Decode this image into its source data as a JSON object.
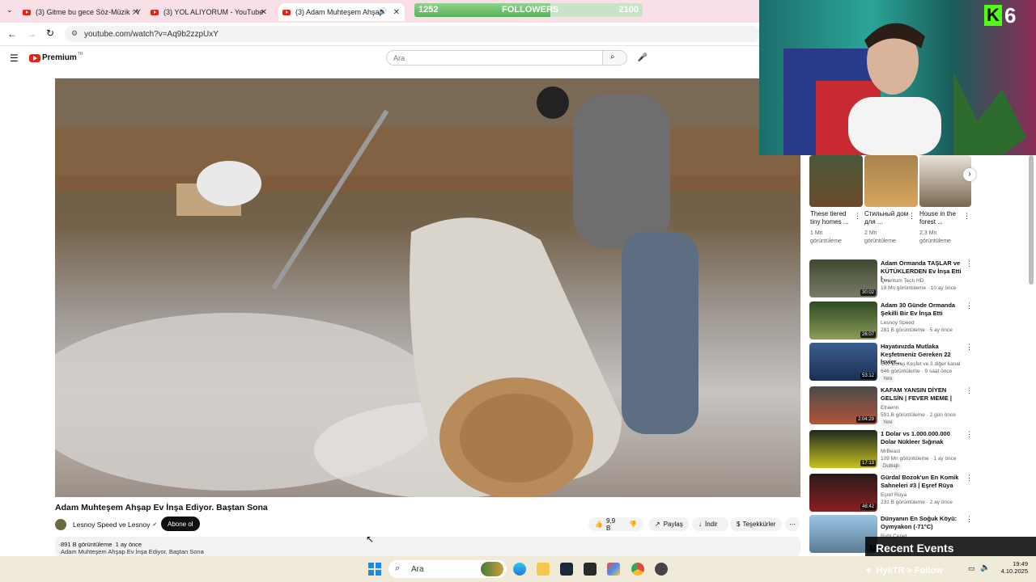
{
  "browser": {
    "tabs": [
      {
        "label": "(3) Gitme bu gece Söz-Müzik : Y"
      },
      {
        "label": "(3) YOL ALIYORUM - YouTube"
      },
      {
        "label": "(3) Adam Muhteşem Ahşap"
      }
    ],
    "url": "youtube.com/watch?v=Aq9b2zzpUxY"
  },
  "stream_overlay": {
    "followers_current": "1252",
    "followers_label": "FOLLOWERS",
    "followers_goal": "2100",
    "followers_progress": 0.596,
    "webcam_badge": "6",
    "recent_events": "Recent Events",
    "follow_cta": "HykTR > Follow"
  },
  "youtube": {
    "brand": "Premium",
    "region": "TR",
    "search_placeholder": "Ara",
    "video": {
      "title": "Adam Muhteşem Ahşap Ev İnşa Ediyor. Baştan Sona",
      "channel": "Lesnoy Speed ve Lesnoy",
      "subscribe": "Abone ol",
      "likes": "9,9 B",
      "share": "Paylaş",
      "download": "İndir",
      "thanks": "Teşekkürler",
      "views": "891 B görüntüleme",
      "age": "1 ay önce",
      "desc_line": "Adam Muhteşem Ahşap Ev İnşa Ediyor. Baştan Sona"
    },
    "shelf": [
      {
        "title": "These tiered tiny homes ...",
        "meta": "1 Mn görüntüleme"
      },
      {
        "title": "Стильный дом для ...",
        "meta": "2 Mn görüntüleme"
      },
      {
        "title": "House in the forest ...",
        "meta": "2,3 Mn görüntüleme"
      }
    ],
    "recommendations": [
      {
        "title": "Adam Ormanda TAŞLAR ve KÜTÜKLERDEN Ev İnşa Etti | ...",
        "channel": "Quantum Tech HD",
        "meta": "19 Mn görüntüleme · 10 ay önce",
        "duration": "30:02"
      },
      {
        "title": "Adam 30 Günde Ormanda Şekilli Bir Ev İnşa Etti",
        "channel": "Lesnoy Speed",
        "meta": "281 B görüntüleme · 5 ay önce",
        "duration": "26:07"
      },
      {
        "title": "Hayatınızda Mutlaka Keşfetmeniz Gereken 22 İsviçr...",
        "channel": "Gez Dolaş Keşfet ve 3 diğer kanal",
        "meta": "646 görüntüleme · 9 saat önce",
        "duration": "53:12",
        "badge": "Yeni"
      },
      {
        "title": "KAFAM YANSIN DİYEN GELSİN | FEVER MEME |",
        "channel": "Elraenn",
        "meta": "591 B görüntüleme · 2 gün önce",
        "duration": "2:04:29",
        "badge": "Yeni"
      },
      {
        "title": "1 Dolar vs 1.000.000.000 Dolar Nükleer Sığınak",
        "channel": "MrBeast",
        "meta": "109 Mn görüntüleme · 1 ay önce",
        "duration": "17:13",
        "badge": "Dublajlı"
      },
      {
        "title": "Gürdal Bozok'un En Komik Sahneleri #3 | Eşref Rüya",
        "channel": "Eşref Rüya",
        "meta": "231 B görüntüleme · 2 ay önce",
        "duration": "48:42"
      },
      {
        "title": "Dünyanın En Soğuk Köyü: Oymyakon (-71°C)",
        "channel": "Ruhi Çenet",
        "meta": "",
        "duration": "2"
      }
    ]
  },
  "taskbar": {
    "search_label": "Ara",
    "time": "19:49",
    "date": "4.10.2025"
  },
  "colors": {
    "yt_red": "#e62117",
    "followers_green": "#55b355",
    "tab_strip": "#f8e0e6"
  }
}
